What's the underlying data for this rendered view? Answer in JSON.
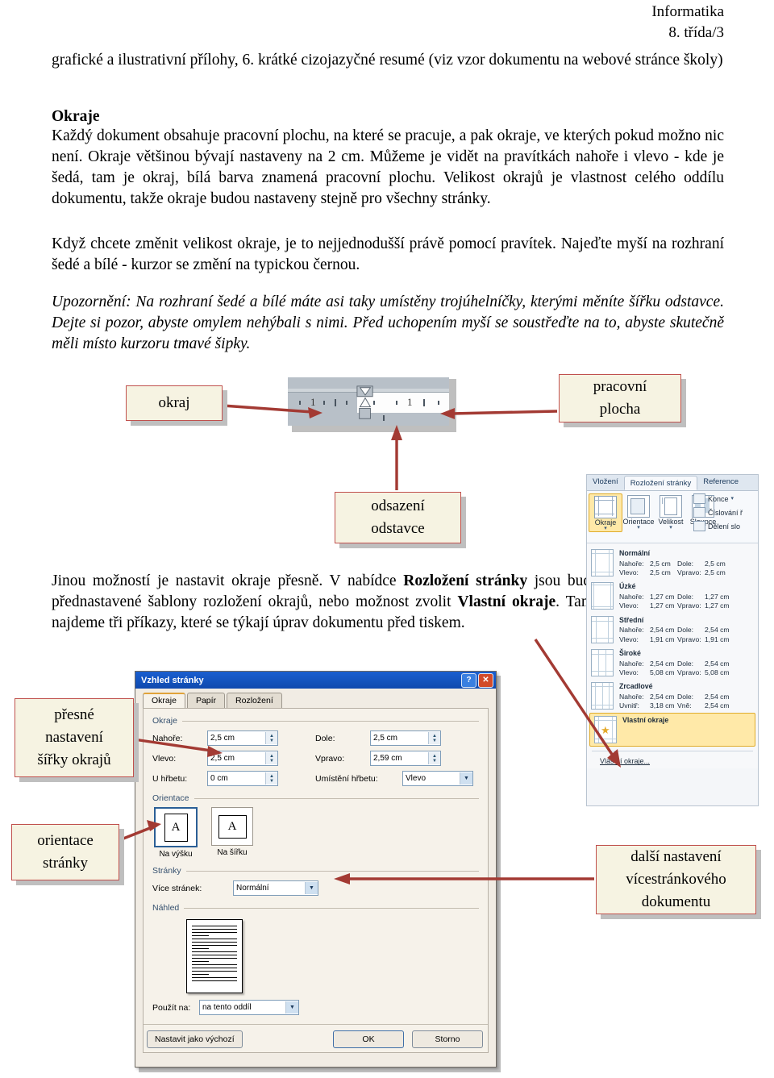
{
  "header": {
    "subject": "Informatika",
    "class": "8. třída/3"
  },
  "body": {
    "para_intro": "grafické a ilustrativní přílohy, 6. krátké cizojazyčné resumé (viz vzor dokumentu na webové stránce školy)",
    "heading_okraje": "Okraje",
    "para1": "Každý dokument obsahuje pracovní plochu, na které se pracuje, a pak okraje, ve kterých pokud možno nic není. Okraje většinou bývají nastaveny na 2 cm. Můžeme je vidět na pravítkách nahoře i vlevo - kde je šedá, tam je okraj, bílá barva znamená pracovní plochu. Velikost okrajů je vlastnost celého oddílu dokumentu, takže okraje budou nastaveny stejně pro všechny stránky.",
    "para2": "Když chcete změnit velikost okraje, je to nejjednodušší právě pomocí pravítek. Najeďte myší na rozhraní šedé a bílé - kurzor se změní na typickou černou.",
    "para_note": "Upozornění: Na rozhraní šedé a bílé máte asi taky umístěny trojúhelníčky, kterými měníte šířku odstavce. Dejte si pozor, abyste omylem nehýbali s nimi. Před uchopením myší se soustřeďte na to, abyste skutečně měli místo kurzoru tmavé šipky.",
    "para3_a": "Jinou možností je nastavit okraje přesně. V nabídce ",
    "para3_b": "Rozložení stránky",
    "para3_c": " jsou buď přednastavené šablony rozložení okrajů, nebo možnost zvolit ",
    "para3_d": "Vlastní okraje",
    "para3_e": ". Tam najdeme tři příkazy, které se týkají úprav dokumentu před tiskem."
  },
  "callouts": {
    "okraj": "okraj",
    "pracovni_plocha": "pracovní\nplocha",
    "pracovni_plocha_l1": "pracovní",
    "pracovni_plocha_l2": "plocha",
    "odsazeni_l1": "odsazení",
    "odsazeni_l2": "odstavce",
    "presne_l1": "přesné",
    "presne_l2": "nastavení",
    "presne_l3": "šířky okrajů",
    "orientace_l1": "orientace",
    "orientace_l2": "stránky",
    "dalsi_l1": "další nastavení",
    "dalsi_l2": "vícestránkového",
    "dalsi_l3": "dokumentu"
  },
  "ruler": {
    "label_left": "1",
    "label_right": "1"
  },
  "ribbon": {
    "tabs": [
      {
        "label": "Vložení",
        "active": false
      },
      {
        "label": "Rozložení stránky",
        "active": true
      },
      {
        "label": "Reference",
        "active": false
      }
    ],
    "buttons": [
      {
        "label": "Okraje",
        "selected": true
      },
      {
        "label": "Orientace",
        "selected": false
      },
      {
        "label": "Velikost",
        "selected": false
      },
      {
        "label": "Sloupce",
        "selected": false
      }
    ],
    "small_buttons": [
      {
        "label": "Konce",
        "caret": "▾"
      },
      {
        "label": "Číslování ř",
        "caret": ""
      },
      {
        "label": "Dělení slo",
        "caret": ""
      }
    ],
    "margin_presets": [
      {
        "title": "Normální",
        "top_label": "Nahoře:",
        "top_value": "2,5 cm",
        "bottom_label": "Dole:",
        "bottom_value": "2,5 cm",
        "left_label": "Vlevo:",
        "left_value": "2,5 cm",
        "right_label": "Vpravo:",
        "right_value": "2,5 cm",
        "selected": false
      },
      {
        "title": "Úzké",
        "top_label": "Nahoře:",
        "top_value": "1,27 cm",
        "bottom_label": "Dole:",
        "bottom_value": "1,27 cm",
        "left_label": "Vlevo:",
        "left_value": "1,27 cm",
        "right_label": "Vpravo:",
        "right_value": "1,27 cm",
        "selected": false
      },
      {
        "title": "Střední",
        "top_label": "Nahoře:",
        "top_value": "2,54 cm",
        "bottom_label": "Dole:",
        "bottom_value": "2,54 cm",
        "left_label": "Vlevo:",
        "left_value": "1,91 cm",
        "right_label": "Vpravo:",
        "right_value": "1,91 cm",
        "selected": false
      },
      {
        "title": "Široké",
        "top_label": "Nahoře:",
        "top_value": "2,54 cm",
        "bottom_label": "Dole:",
        "bottom_value": "2,54 cm",
        "left_label": "Vlevo:",
        "left_value": "5,08 cm",
        "right_label": "Vpravo:",
        "right_value": "5,08 cm",
        "selected": false
      },
      {
        "title": "Zrcadlové",
        "top_label": "Nahoře:",
        "top_value": "2,54 cm",
        "bottom_label": "Dole:",
        "bottom_value": "2,54 cm",
        "left_label": "Uvnitř:",
        "left_value": "3,18 cm",
        "right_label": "Vně:",
        "right_value": "2,54 cm",
        "selected": false
      },
      {
        "title": "Vlastní okraje",
        "top_label": "",
        "top_value": "",
        "bottom_label": "",
        "bottom_value": "",
        "left_label": "",
        "left_value": "",
        "right_label": "",
        "right_value": "",
        "selected": true
      }
    ],
    "footer_item": "Vlastní okraje..."
  },
  "dialog": {
    "title": "Vzhled stránky",
    "help_icon": "?",
    "close_icon": "✕",
    "tabs": [
      {
        "label": "Okraje",
        "active": true
      },
      {
        "label": "Papír",
        "active": false
      },
      {
        "label": "Rozložení",
        "active": false
      }
    ],
    "group_margins": "Okraje",
    "fields": {
      "top_label": "Nahoře:",
      "top_value": "2,5 cm",
      "bottom_label": "Dole:",
      "bottom_value": "2,5 cm",
      "left_label": "Vlevo:",
      "left_value": "2,5 cm",
      "right_label": "Vpravo:",
      "right_value": "2,59 cm",
      "gutter_label": "U hřbetu:",
      "gutter_value": "0 cm",
      "gutter_pos_label": "Umístění hřbetu:",
      "gutter_pos_value": "Vlevo"
    },
    "group_orientation": "Orientace",
    "orientation": [
      {
        "label": "Na výšku",
        "selected": true
      },
      {
        "label": "Na šířku",
        "selected": false
      }
    ],
    "group_pages": "Stránky",
    "multi_pages_label": "Více stránek:",
    "multi_pages_value": "Normální",
    "group_preview": "Náhled",
    "apply_label": "Použít na:",
    "apply_value": "na tento oddíl",
    "buttons": {
      "default": "Nastavit jako výchozí",
      "ok": "OK",
      "cancel": "Storno"
    }
  },
  "colors": {
    "callout_bg": "#f6f3e2",
    "callout_border": "#c0504d",
    "arrow": "#a33a33",
    "title_bar": "#1a5fd0",
    "ribbon_highlight": "#ffe9a8"
  }
}
